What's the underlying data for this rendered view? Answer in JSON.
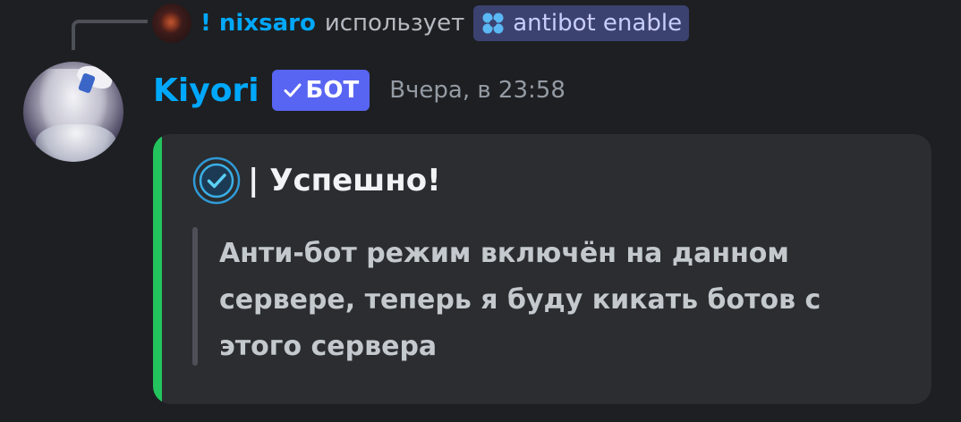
{
  "reply": {
    "prefix": "!",
    "username": "nixsaro",
    "action_text": "использует",
    "command": "antibot enable",
    "command_icon": "slash-command-icon"
  },
  "message": {
    "author": "Kiyori",
    "bot_tag": "БОТ",
    "timestamp": "Вчера, в 23:58",
    "avatar_icon": "avatar-image"
  },
  "embed": {
    "accent_color": "#23c45e",
    "title": "| Успешно!",
    "title_icon": "verified-check-icon",
    "description": "Анти-бот режим включён на данном сервере, теперь я буду кикать ботов с этого сервера"
  },
  "colors": {
    "username": "#00a8fc",
    "bot_tag_bg": "#5865f2",
    "background": "#1e1f22",
    "embed_bg": "#2b2d31"
  }
}
